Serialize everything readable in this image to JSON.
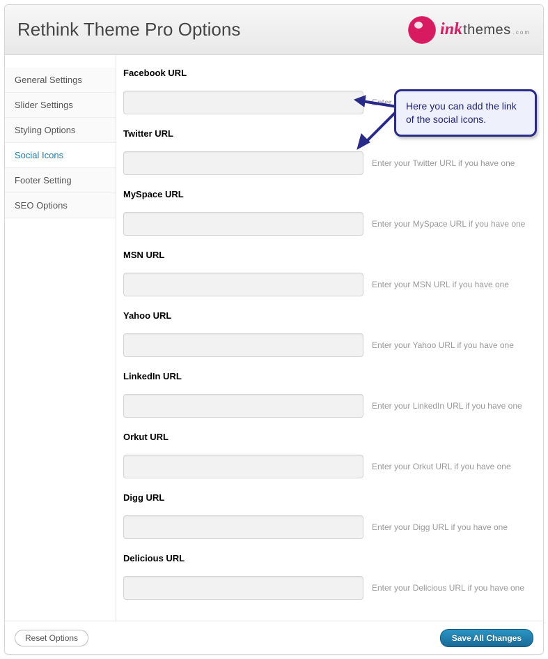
{
  "header": {
    "title": "Rethink Theme Pro Options",
    "logo_brand_a": "ink",
    "logo_brand_b": "themes",
    "logo_suffix": ".com"
  },
  "sidebar": {
    "items": [
      {
        "label": "General Settings",
        "active": false
      },
      {
        "label": "Slider Settings",
        "active": false
      },
      {
        "label": "Styling Options",
        "active": false
      },
      {
        "label": "Social Icons",
        "active": true
      },
      {
        "label": "Footer Setting",
        "active": false
      },
      {
        "label": "SEO Options",
        "active": false
      }
    ]
  },
  "fields": [
    {
      "label": "Facebook URL",
      "help": "Enter your Facebook URL if you have one",
      "value": ""
    },
    {
      "label": "Twitter URL",
      "help": "Enter your Twitter URL if you have one",
      "value": ""
    },
    {
      "label": "MySpace URL",
      "help": "Enter your MySpace URL if you have one",
      "value": ""
    },
    {
      "label": "MSN URL",
      "help": "Enter your MSN URL if you have one",
      "value": ""
    },
    {
      "label": "Yahoo URL",
      "help": "Enter your Yahoo URL if you have one",
      "value": ""
    },
    {
      "label": "LinkedIn URL",
      "help": "Enter your LinkedIn URL if you have one",
      "value": ""
    },
    {
      "label": "Orkut URL",
      "help": "Enter your Orkut URL if you have one",
      "value": ""
    },
    {
      "label": "Digg URL",
      "help": "Enter your Digg URL if you have one",
      "value": ""
    },
    {
      "label": "Delicious URL",
      "help": "Enter your Delicious URL if you have one",
      "value": ""
    }
  ],
  "footer": {
    "reset": "Reset Options",
    "save": "Save All Changes"
  },
  "callout": {
    "text": "Here you can add the link of the social icons."
  }
}
